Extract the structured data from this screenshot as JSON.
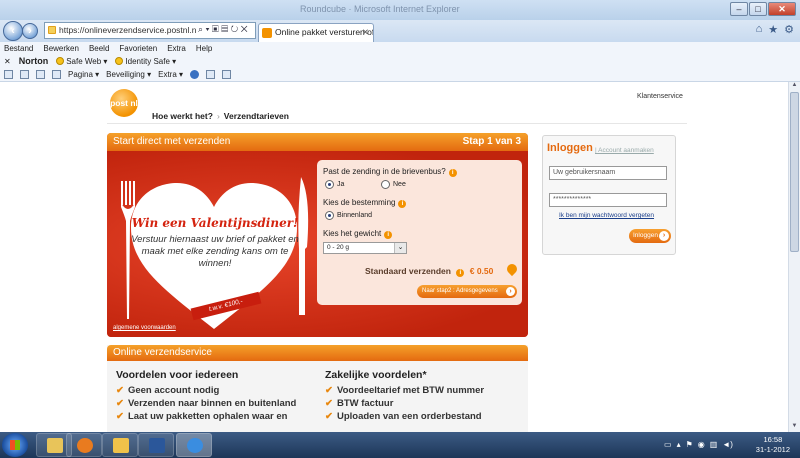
{
  "browser": {
    "window_title_faint": "Roundcube · Microsoft Internet Explorer",
    "address": "https://onlineverzendservice.postnl.nl/?binnen",
    "tab_title": "Online pakket versturen of ...",
    "menu": [
      "Bestand",
      "Bewerken",
      "Beeld",
      "Favorieten",
      "Extra",
      "Help"
    ],
    "norton": {
      "brand": "Norton",
      "safe_web": "Safe Web",
      "identity_safe": "Identity Safe"
    },
    "commands": {
      "pagina": "Pagina",
      "beveiliging": "Beveiliging",
      "extra": "Extra"
    }
  },
  "site": {
    "logo": "post nl",
    "klantenservice": "Klantenservice",
    "nav": [
      "Hoe werkt het?",
      "Verzendtarieven"
    ]
  },
  "panel": {
    "title": "Start direct met verzenden",
    "step": "Stap 1 van 3",
    "promo_heading": "Win een Valentijnsdiner!",
    "promo_text": "Verstuur hiernaast uw brief of pakket en maak met elke zending kans om te winnen!",
    "ribbon": "t.w.v. €100,-",
    "terms": "algemene voorwaarden"
  },
  "form": {
    "q1": "Past de zending in de brievenbus?",
    "opt_ja": "Ja",
    "opt_nee": "Nee",
    "q2": "Kies de bestemming",
    "opt_binnenland": "Binnenland",
    "q3": "Kies het gewicht",
    "weight_selected": "0 - 20 g",
    "price_label": "Standaard verzenden",
    "price_value": "€ 0.50",
    "next_button": "Naar stap2 : Adresgegevens"
  },
  "login": {
    "title": "Inloggen",
    "create_account": "| Account aanmaken",
    "username_placeholder": "Uw gebruikersnaam",
    "password_value": "**************",
    "forgot": "Ik ben mijn wachtwoord vergeten",
    "button": "Inloggen"
  },
  "service": {
    "title": "Online verzendservice",
    "col1_title": "Voordelen voor iedereen",
    "col1_items": [
      "Geen account nodig",
      "Verzenden naar binnen en buitenland",
      "Laat uw pakketten ophalen waar en"
    ],
    "col2_title": "Zakelijke voordelen*",
    "col2_items": [
      "Voordeeltarief met BTW nummer",
      "BTW factuur",
      "Uploaden van een orderbestand"
    ]
  },
  "taskbar": {
    "time": "16:58",
    "date": "31-1-2012"
  },
  "colors": {
    "brand_orange": "#f39200",
    "promo_red": "#d8391c"
  }
}
